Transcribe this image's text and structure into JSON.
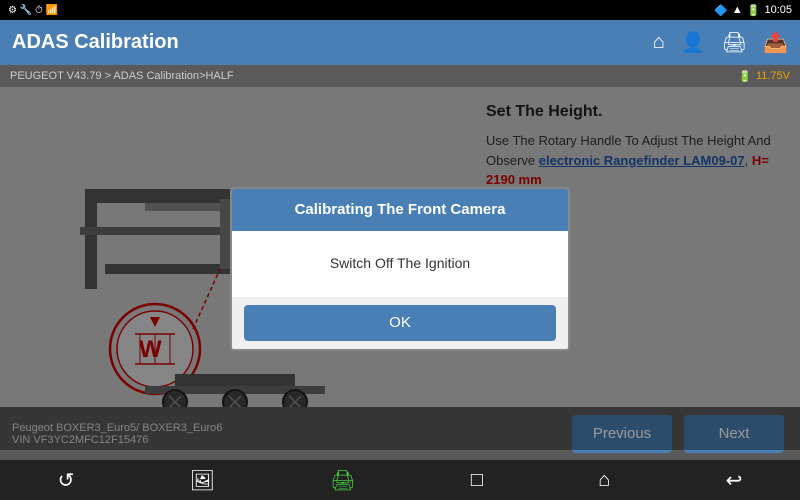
{
  "statusBar": {
    "time": "10:05"
  },
  "header": {
    "title": "ADAS Calibration",
    "icons": [
      "home",
      "user",
      "print",
      "export"
    ]
  },
  "breadcrumb": {
    "path": "PEUGEOT V43.79 > ADAS Calibration>HALF",
    "voltage": "11.75V"
  },
  "instructions": {
    "title": "Set The Height.",
    "text1": "Use The Rotary Handle To Adjust The Height And Observe ",
    "linkText": "electronic Rangefinder LAM09-07",
    "text2": ", ",
    "highlightText": "H= 2190 mm"
  },
  "modal": {
    "title": "Calibrating The Front Camera",
    "body": "Switch Off The Ignition",
    "ok_label": "OK"
  },
  "bottomBar": {
    "info1": "Peugeot BOXER3_Euro5/ BOXER3_Euro6",
    "info2": "VIN VF3YC2MFC12F15476",
    "prevLabel": "Previous",
    "nextLabel": "Next"
  },
  "navBar": {
    "icons": [
      "circle-arrow",
      "image",
      "printer",
      "square",
      "home",
      "back"
    ]
  }
}
